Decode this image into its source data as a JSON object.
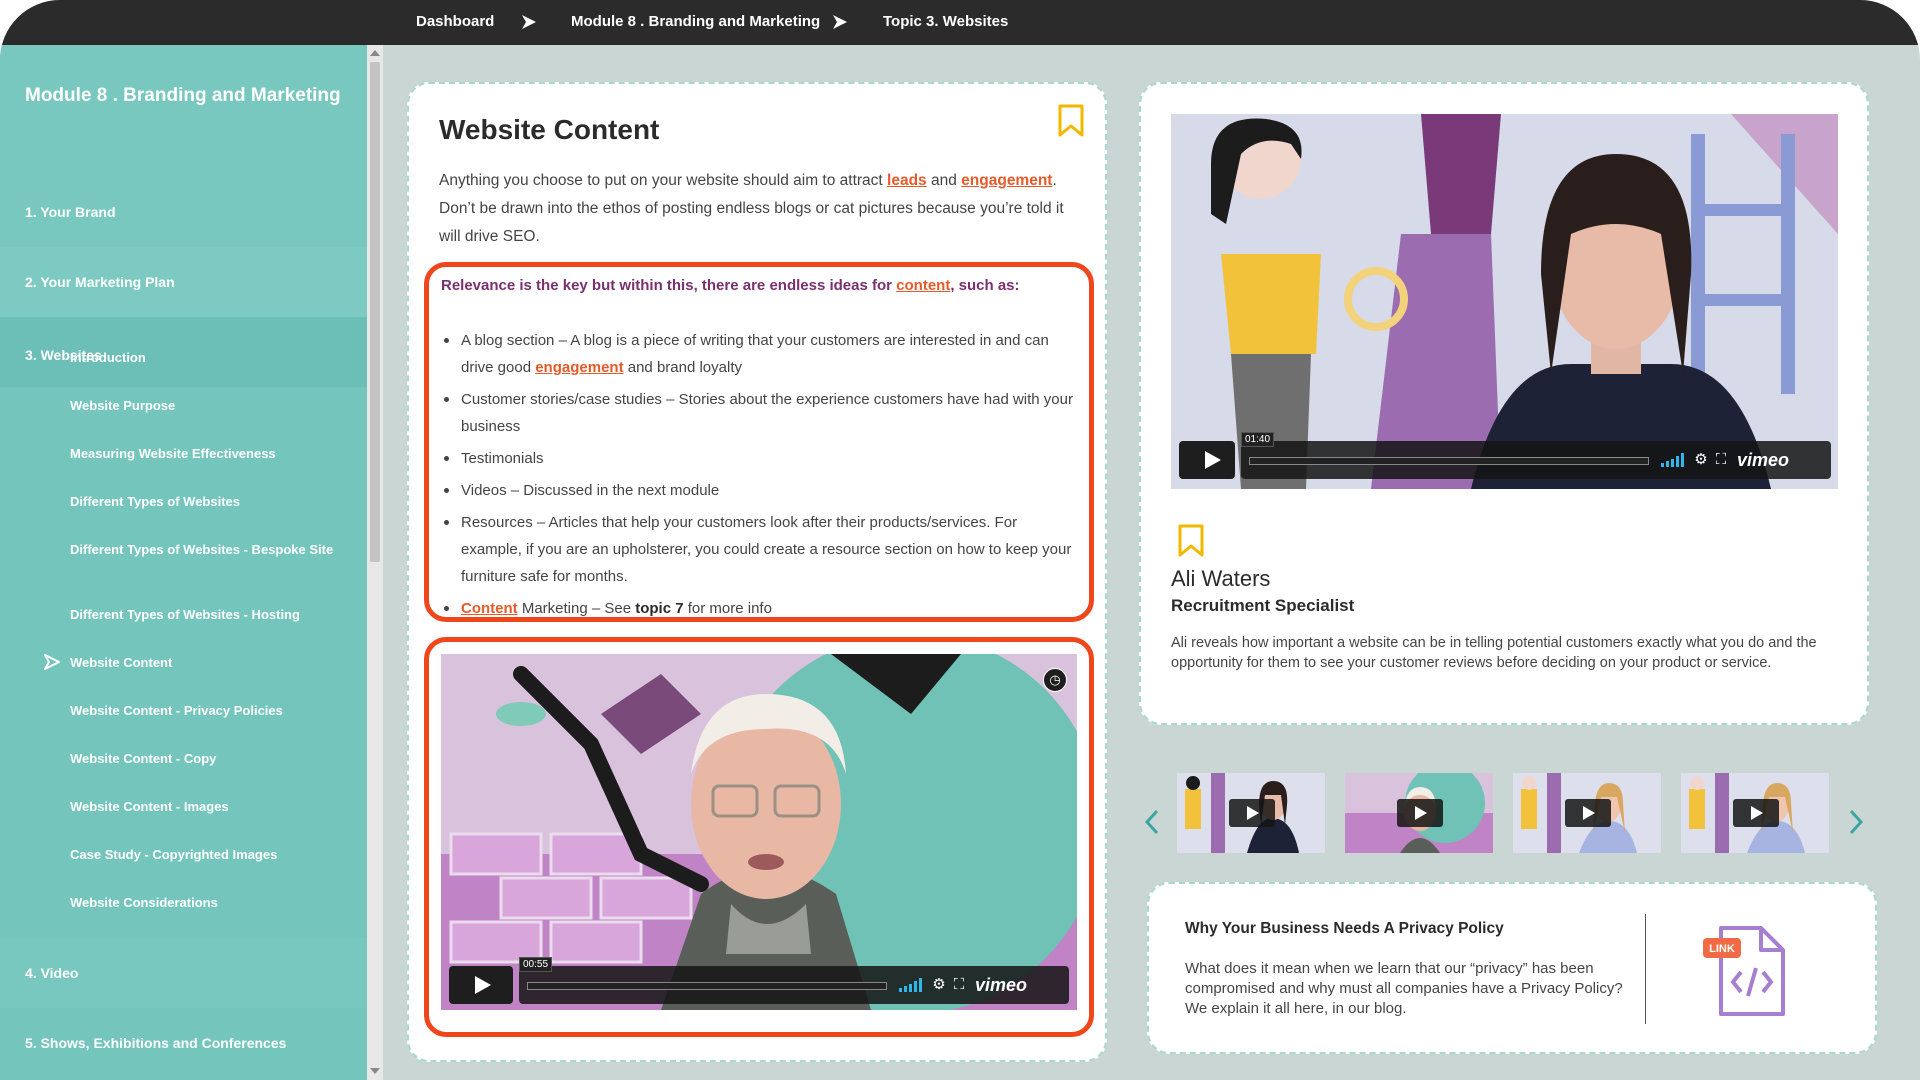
{
  "breadcrumb": {
    "items": [
      "Dashboard",
      "Module 8 . Branding and Marketing",
      "Topic 3. Websites"
    ]
  },
  "sidebar": {
    "title": "Module 8 . Branding and Marketing",
    "sections": [
      {
        "label": "1. Your Brand"
      },
      {
        "label": "2. Your Marketing Plan"
      },
      {
        "label": "3. Websites"
      },
      {
        "label": "4. Video"
      },
      {
        "label": "5. Shows, Exhibitions and Conferences"
      }
    ],
    "subitems": [
      {
        "label": "Introduction"
      },
      {
        "label": "Website Purpose"
      },
      {
        "label": "Measuring Website Effectiveness"
      },
      {
        "label": "Different Types of Websites"
      },
      {
        "label": "Different Types of Websites - Bespoke Site"
      },
      {
        "label": "Different Types of Websites - Hosting"
      },
      {
        "label": "Website Content"
      },
      {
        "label": "Website Content - Privacy Policies"
      },
      {
        "label": "Website Content - Copy"
      },
      {
        "label": "Website Content - Images"
      },
      {
        "label": "Case Study - Copyrighted Images"
      },
      {
        "label": "Website Considerations"
      }
    ],
    "active_subitem": "Website Content"
  },
  "content": {
    "title": "Website Content",
    "para": {
      "p1": "Anything you choose to put on your website should aim to attract ",
      "link_leads": "leads",
      "p2": " and ",
      "link_engagement": "engagement",
      "p3": ". Don’t be drawn into the ethos of posting endless blogs or cat pictures because you’re told it will drive SEO."
    },
    "lead": {
      "text1": "Relevance is the key but within this, there are endless ideas for ",
      "link_content": "content",
      "text2": ", such as:"
    },
    "bullets": {
      "b1_a": "A blog section – A blog is a piece of writing that your customers are interested in and can drive good ",
      "b1_link": "engagement",
      "b1_b": " and brand loyalty",
      "b2": "Customer stories/case studies – Stories about the experience customers have had with your business",
      "b3": "Testimonials",
      "b4": "Videos – Discussed in the next module",
      "b5": "Resources – Articles that help your customers look after their products/services. For example, if you are an upholsterer, you could create a resource section on how to keep your furniture safe for months.",
      "b6_link": "Content",
      "b6_a": " Marketing – See ",
      "b6_bold": "topic 7",
      "b6_b": " for more info"
    },
    "video": {
      "timecode": "00:55",
      "brand": "vimeo"
    }
  },
  "featured": {
    "video": {
      "timecode": "01:40",
      "brand": "vimeo"
    },
    "name": "Ali Waters",
    "role": "Recruitment Specialist",
    "description": "Ali reveals how important a website can be in telling potential customers exactly what you do and the opportunity for them to see your customer reviews before deciding on your product or service."
  },
  "thumbnails": {
    "count": 4
  },
  "blog": {
    "title": "Why Your Business Needs A Privacy Policy",
    "description": "What does it mean when we learn that our “privacy” has been compromised and why must all companies have a Privacy Policy? We explain it all here, in our blog.",
    "icon_label": "LINK"
  },
  "colors": {
    "sidebar": "#74c6bd",
    "accent_red": "#f0461c",
    "link": "#e75a2a",
    "lead_purple": "#7a3070",
    "bookmark": "#f2b800",
    "topbar": "#2b2b2b"
  }
}
